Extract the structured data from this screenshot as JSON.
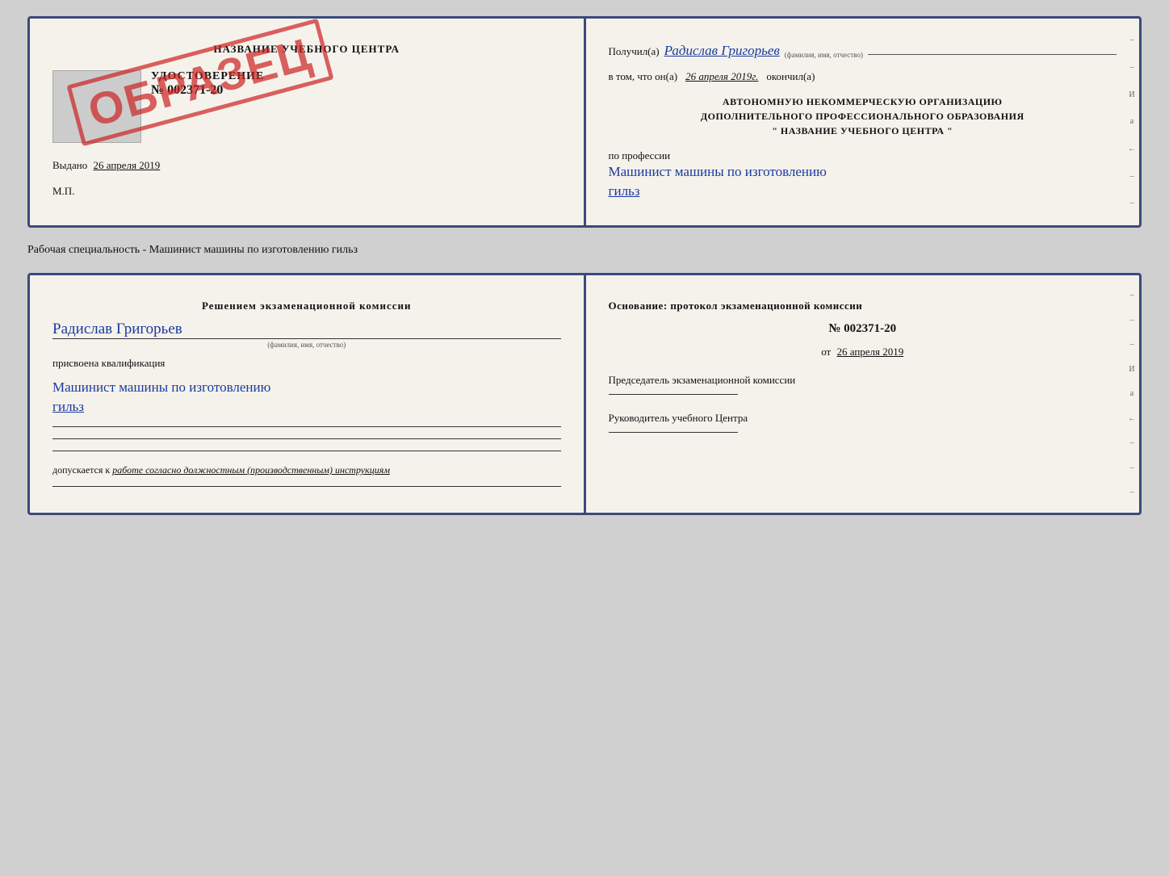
{
  "top_card": {
    "left": {
      "center_name": "НАЗВАНИЕ УЧЕБНОГО ЦЕНТРА",
      "gray_box_label": "",
      "udostoverenie_title": "УДОСТОВЕРЕНИЕ",
      "udostoverenie_num": "№ 002371-20",
      "vydano_label": "Выдано",
      "vydano_date": "26 апреля 2019",
      "mp_label": "М.П.",
      "obrazets_text": "ОБРАЗЕЦ"
    },
    "right": {
      "poluchil_prefix": "Получил(а)",
      "person_name": "Радислав Григорьев",
      "fio_hint": "(фамилия, имя, отчество)",
      "vtom_prefix": "в том, что он(а)",
      "vtom_date": "26 апреля 2019г.",
      "okonchil": "окончил(а)",
      "org_line1": "АВТОНОМНУЮ НЕКОММЕРЧЕСКУЮ ОРГАНИЗАЦИЮ",
      "org_line2": "ДОПОЛНИТЕЛЬНОГО ПРОФЕССИОНАЛЬНОГО ОБРАЗОВАНИЯ",
      "org_line3": "\"    НАЗВАНИЕ УЧЕБНОГО ЦЕНТРА    \"",
      "po_professii": "по профессии",
      "profession": "Машинист машины по изготовлению",
      "profession2": "гильз"
    }
  },
  "specialnost_label": "Рабочая специальность - Машинист машины по изготовлению гильз",
  "bottom_card": {
    "left": {
      "resheniyem_header": "Решением  экзаменационной  комиссии",
      "person_name": "Радислав Григорьев",
      "fio_hint": "(фамилия, имя, отчество)",
      "prisvoena": "присвоена квалификация",
      "qualification": "Машинист машины по изготовлению",
      "qualification2": "гильз",
      "dopuskaetsya_label": "допускается к",
      "dopuskaetsya_text": "работе согласно должностным (производственным) инструкциям"
    },
    "right": {
      "osnovanie_header": "Основание: протокол экзаменационной  комиссии",
      "num": "№  002371-20",
      "ot_label": "от",
      "ot_date": "26 апреля 2019",
      "predsedatel_title": "Председатель экзаменационной комиссии",
      "rukovoditel_title": "Руководитель учебного Центра"
    }
  },
  "side_chars": [
    "–",
    "–",
    "–",
    "И",
    "а",
    "←",
    "–",
    "–",
    "–"
  ]
}
